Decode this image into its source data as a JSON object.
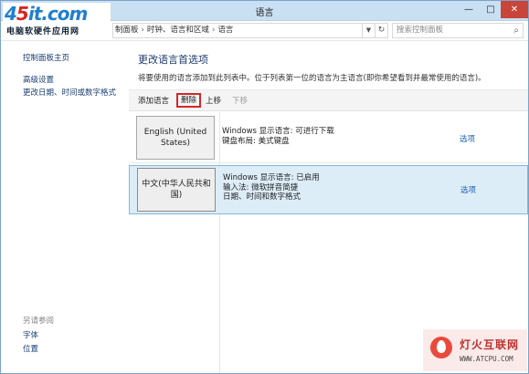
{
  "window": {
    "title": "语言",
    "minimize": "—",
    "maximize": "□",
    "close": "✕"
  },
  "logo": {
    "mark_left": "4",
    "mark_red": "5",
    "mark_right": "it.com",
    "subtitle": "电脑软硬件应用网"
  },
  "addressbar": {
    "crumbs": [
      "制面板",
      "时钟、语言和区域",
      "语言"
    ],
    "search_placeholder": "搜索控制面板"
  },
  "leftnav": {
    "home": "控制面板主页",
    "advanced": "高级设置",
    "date_time": "更改日期、时间或数字格式",
    "see_also_heading": "另请参阅",
    "fonts": "字体",
    "location": "位置"
  },
  "main": {
    "title": "更改语言首选项",
    "description": "将要使用的语言添加到此列表中。位于列表第一位的语言为主语言(即你希望看到并最常使用的语言)。",
    "toolbar": {
      "add": "添加语言",
      "delete": "删除",
      "move_up": "上移",
      "move_down": "下移"
    },
    "languages": [
      {
        "name": "English (United States)",
        "lines": [
          "Windows 显示语言: 可进行下载",
          "键盘布局: 美式键盘"
        ],
        "options": "选项"
      },
      {
        "name": "中文(中华人民共和国)",
        "lines": [
          "Windows 显示语言: 已启用",
          "输入法: 微软拼音简捷",
          "日期、时间和数字格式"
        ],
        "options": "选项"
      }
    ]
  },
  "watermark": {
    "line1": "灯火互联网",
    "line2": "WWW.ATCPU.COM"
  },
  "colors": {
    "selected_row": "#ddedf8",
    "delete_highlight": "#d42727",
    "link": "#1a5fb4"
  }
}
